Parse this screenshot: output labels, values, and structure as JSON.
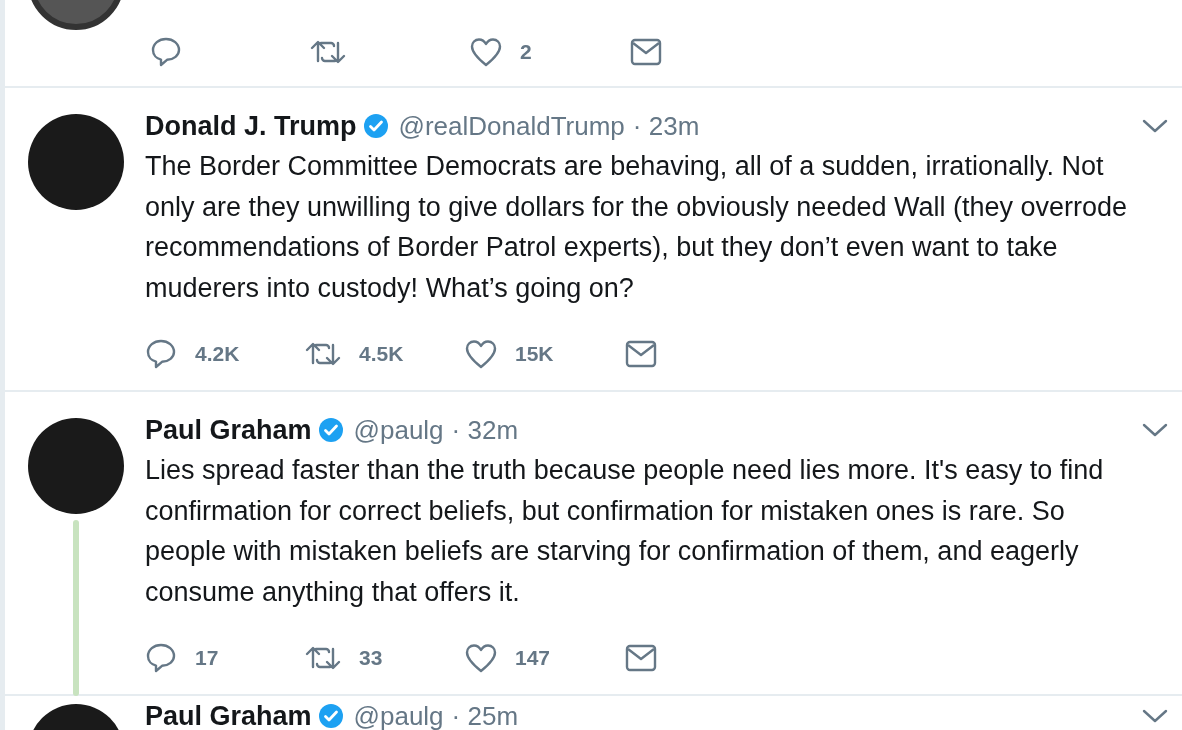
{
  "tweets": [
    {
      "kind": "partial",
      "actions": {
        "likes": "2"
      }
    },
    {
      "kind": "full",
      "name": "Donald J. Trump",
      "verified": true,
      "handle": "@realDonaldTrump",
      "time": "· 23m",
      "thread_line": false,
      "text": "The Border Committee Democrats are behaving, all of a sudden, irrationally. Not only are they unwilling to give dollars for the obviously needed Wall (they overrode recommendations of Border Patrol experts), but they don’t even want to take muderers into custody! What’s going on?",
      "actions": {
        "replies": "4.2K",
        "retweets": "4.5K",
        "likes": "15K"
      }
    },
    {
      "kind": "full",
      "name": "Paul Graham",
      "verified": true,
      "handle": "@paulg",
      "time": "· 32m",
      "thread_line": true,
      "text": "Lies spread faster than the truth because people need lies more. It's easy to find confirmation for correct beliefs, but confirmation for mistaken ones is rare. So people with mistaken beliefs are starving for confirmation of them, and eagerly consume anything that offers it.",
      "actions": {
        "replies": "17",
        "retweets": "33",
        "likes": "147"
      }
    },
    {
      "kind": "header",
      "name": "Paul Graham",
      "verified": true,
      "handle": "@paulg",
      "time": "· 25m",
      "thread_line": false
    }
  ]
}
